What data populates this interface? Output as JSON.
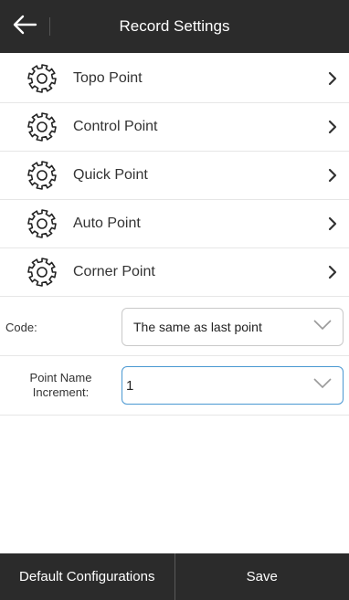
{
  "header": {
    "title": "Record Settings",
    "back_icon": "back-arrow-icon"
  },
  "menu": {
    "items": [
      {
        "label": "Topo Point",
        "icon": "gear-icon"
      },
      {
        "label": "Control Point",
        "icon": "gear-icon"
      },
      {
        "label": "Quick Point",
        "icon": "gear-icon"
      },
      {
        "label": "Auto Point",
        "icon": "gear-icon"
      },
      {
        "label": "Corner Point",
        "icon": "gear-icon"
      }
    ]
  },
  "form": {
    "code": {
      "label": "Code:",
      "value": "The same as last point"
    },
    "increment": {
      "label_line1": "Point Name",
      "label_line2": "Increment:",
      "value": "1"
    }
  },
  "footer": {
    "default_label": "Default Configurations",
    "save_label": "Save"
  },
  "colors": {
    "bar_background": "#2b2b2b",
    "focus_border": "#4a98d2"
  }
}
